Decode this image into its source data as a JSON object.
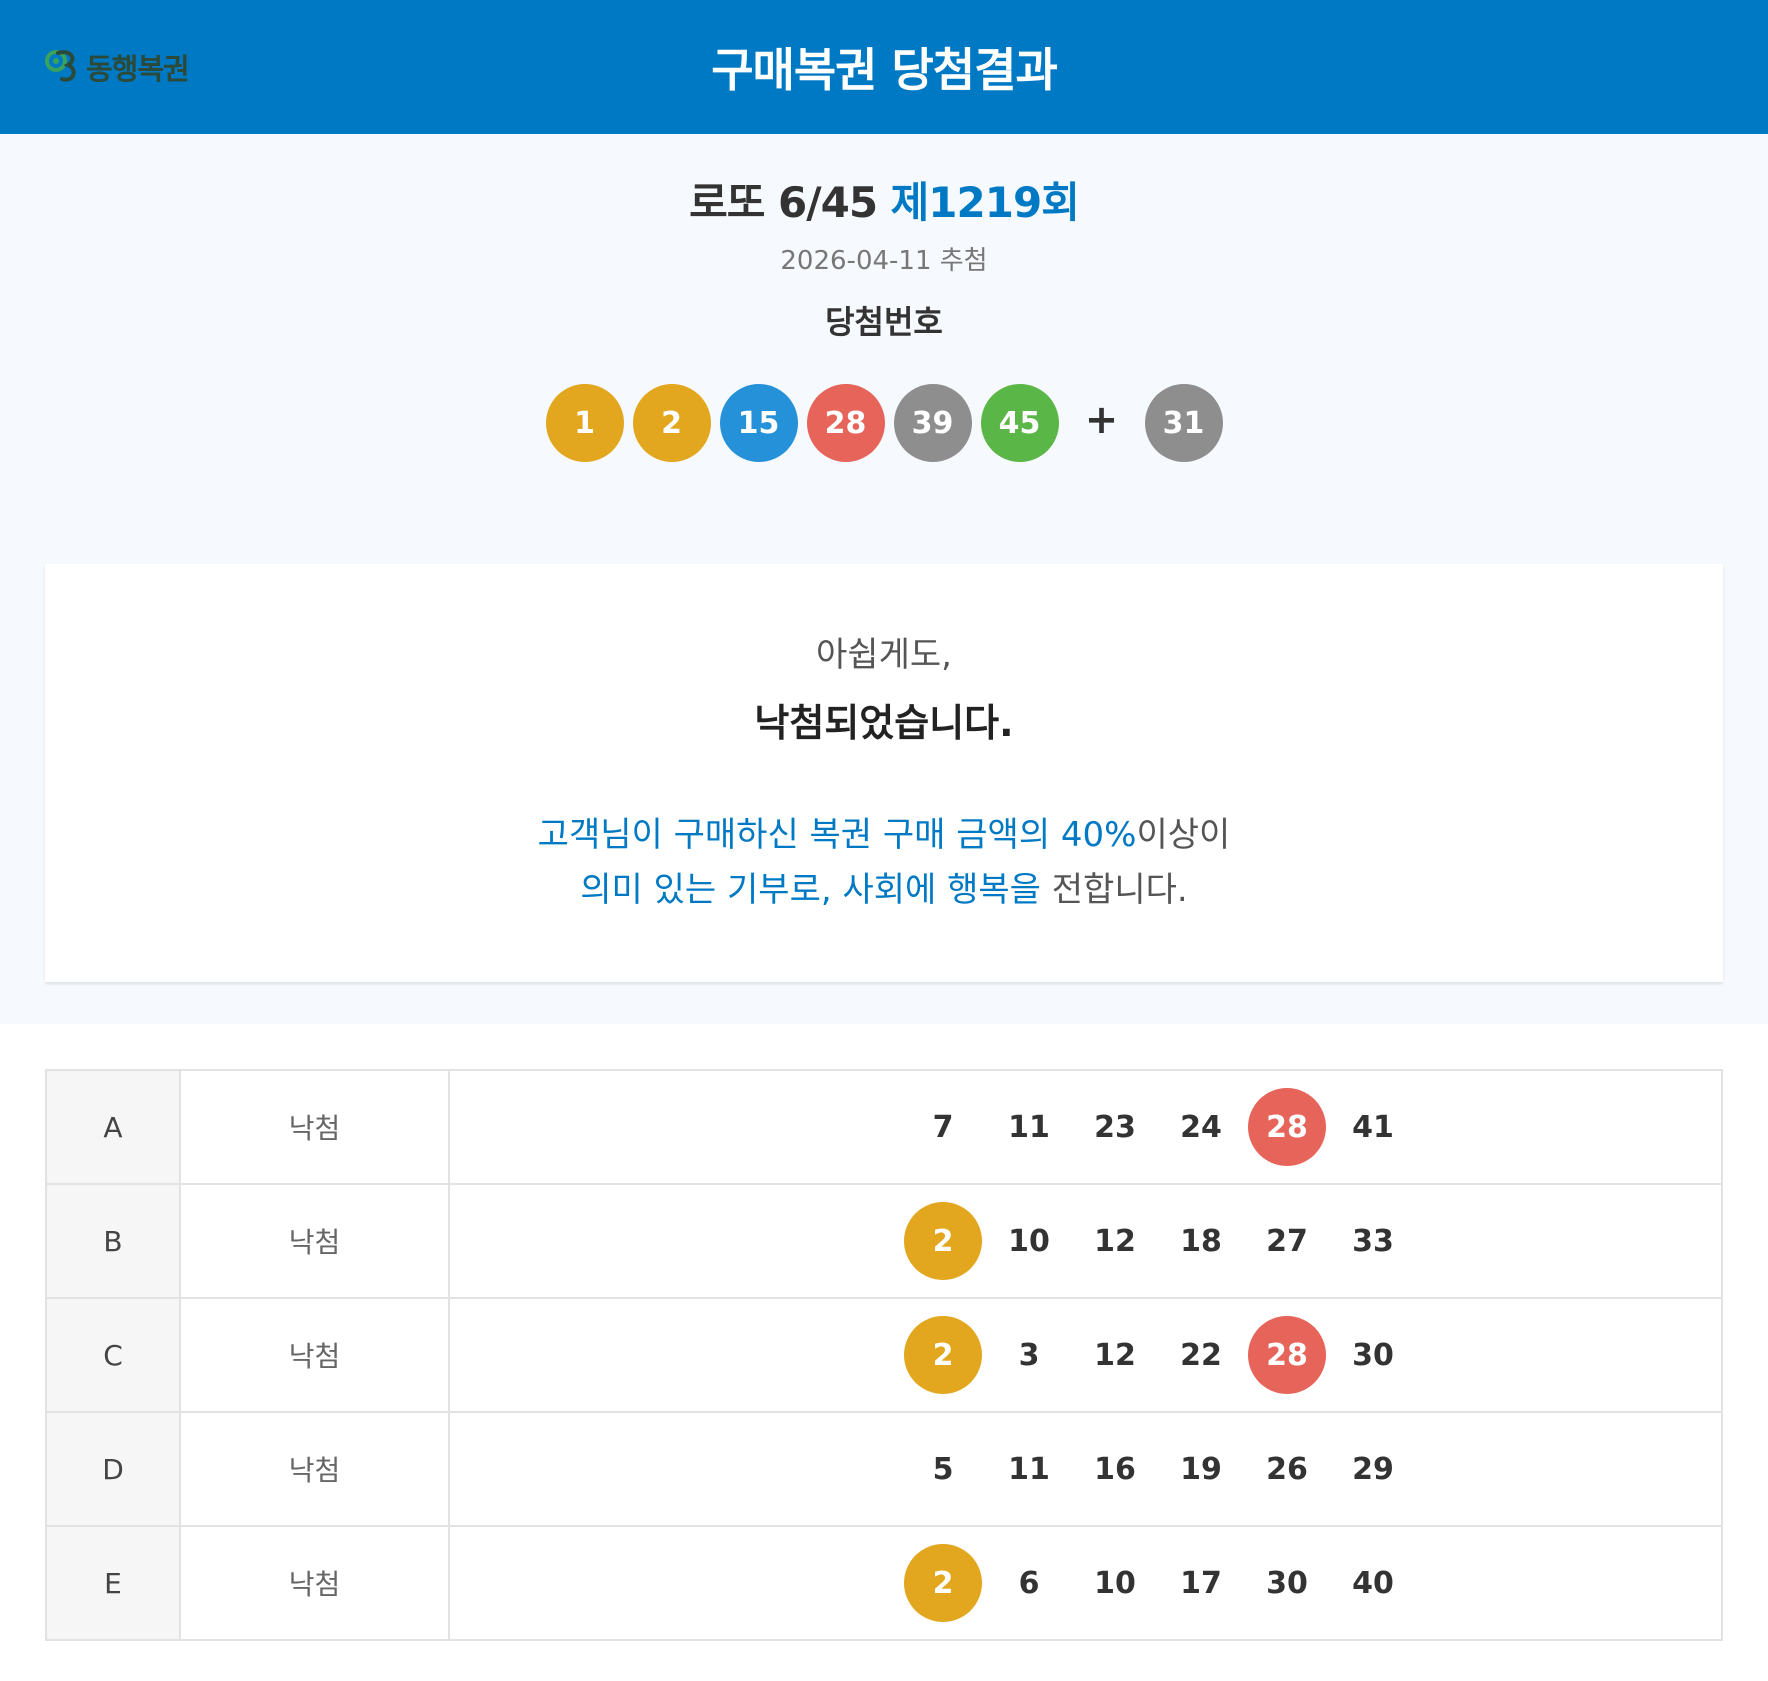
{
  "header": {
    "logo_text": "동행복권",
    "title": "구매복권 당첨결과"
  },
  "draw": {
    "game_name": "로또 6/45",
    "round": "제1219회",
    "date": "2026-04-11 추첨",
    "winning_label": "당첨번호",
    "plus": "+",
    "numbers": [
      {
        "value": "1",
        "color": "#e2a71e"
      },
      {
        "value": "2",
        "color": "#e2a71e"
      },
      {
        "value": "15",
        "color": "#2591d8"
      },
      {
        "value": "28",
        "color": "#e6645a"
      },
      {
        "value": "39",
        "color": "#8e8e8e"
      },
      {
        "value": "45",
        "color": "#5ab747"
      }
    ],
    "bonus": {
      "value": "31",
      "color": "#8e8e8e"
    }
  },
  "result": {
    "sorry": "아쉽게도,",
    "lost": "낙첨되었습니다.",
    "donation_line1_blue": "고객님이 구매하신 복권 구매 금액의 40%",
    "donation_line1_gray": "이상이",
    "donation_line2_blue": "의미 있는 기부로, 사회에 행복을",
    "donation_line2_gray": "전합니다."
  },
  "colors": {
    "header": "#0079c4",
    "round": "#0079c4"
  },
  "games": [
    {
      "id": "A",
      "status": "낙첨",
      "numbers": [
        {
          "value": "7",
          "hit": false
        },
        {
          "value": "11",
          "hit": false
        },
        {
          "value": "23",
          "hit": false
        },
        {
          "value": "24",
          "hit": false
        },
        {
          "value": "28",
          "hit": true,
          "color": "#e6645a"
        },
        {
          "value": "41",
          "hit": false
        }
      ]
    },
    {
      "id": "B",
      "status": "낙첨",
      "numbers": [
        {
          "value": "2",
          "hit": true,
          "color": "#e2a71e"
        },
        {
          "value": "10",
          "hit": false
        },
        {
          "value": "12",
          "hit": false
        },
        {
          "value": "18",
          "hit": false
        },
        {
          "value": "27",
          "hit": false
        },
        {
          "value": "33",
          "hit": false
        }
      ]
    },
    {
      "id": "C",
      "status": "낙첨",
      "numbers": [
        {
          "value": "2",
          "hit": true,
          "color": "#e2a71e"
        },
        {
          "value": "3",
          "hit": false
        },
        {
          "value": "12",
          "hit": false
        },
        {
          "value": "22",
          "hit": false
        },
        {
          "value": "28",
          "hit": true,
          "color": "#e6645a"
        },
        {
          "value": "30",
          "hit": false
        }
      ]
    },
    {
      "id": "D",
      "status": "낙첨",
      "numbers": [
        {
          "value": "5",
          "hit": false
        },
        {
          "value": "11",
          "hit": false
        },
        {
          "value": "16",
          "hit": false
        },
        {
          "value": "19",
          "hit": false
        },
        {
          "value": "26",
          "hit": false
        },
        {
          "value": "29",
          "hit": false
        }
      ]
    },
    {
      "id": "E",
      "status": "낙첨",
      "numbers": [
        {
          "value": "2",
          "hit": true,
          "color": "#e2a71e"
        },
        {
          "value": "6",
          "hit": false
        },
        {
          "value": "10",
          "hit": false
        },
        {
          "value": "17",
          "hit": false
        },
        {
          "value": "30",
          "hit": false
        },
        {
          "value": "40",
          "hit": false
        }
      ]
    }
  ]
}
